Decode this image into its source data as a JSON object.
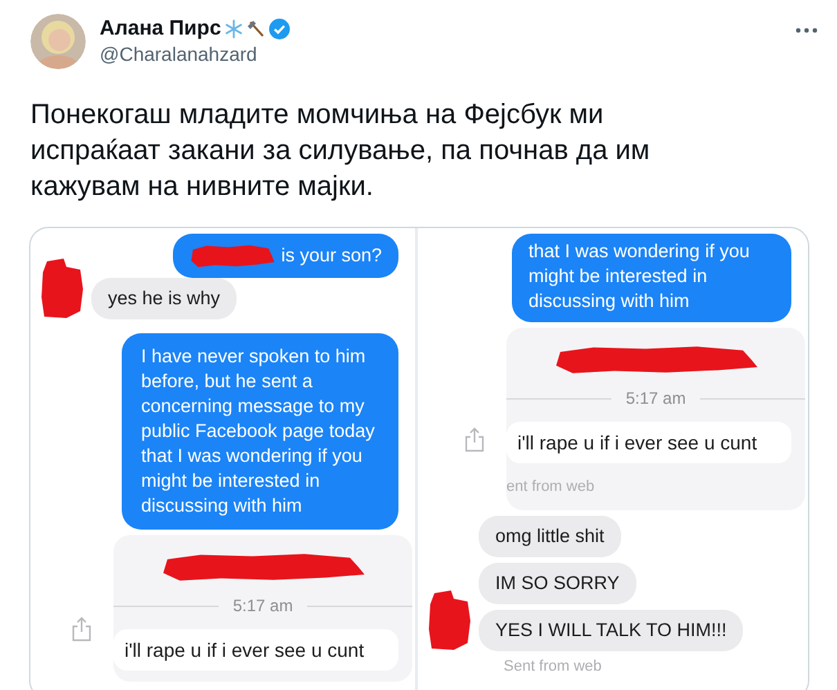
{
  "author": {
    "name": "Алана Пирс",
    "handle": "@Charalanahzard",
    "verified": true
  },
  "tweet": {
    "text": "Понекогаш младите момчиња на Фејсбук ми испраќаат закани за силување, па почнав да им кажувам на нивните мајки."
  },
  "media": {
    "panels": [
      {
        "messages": [
          {
            "kind": "sent",
            "text": "is your son?",
            "redacted": true
          },
          {
            "kind": "received",
            "text": "yes he is why",
            "avatar": true
          },
          {
            "kind": "sent",
            "text": "I have never spoken to him before, but he sent a concerning message to my public Facebook page today that I was wondering if you might be interested in discussing with him",
            "redacted": false
          },
          {
            "kind": "shared",
            "time": "5:17 am",
            "text": "i'll rape u if i ever see u cunt"
          }
        ]
      },
      {
        "messages": [
          {
            "kind": "sent",
            "text": "that I was wondering if you might be interested in discussing with him",
            "redacted": false
          },
          {
            "kind": "shared",
            "time": "5:17 am",
            "text": "i'll rape u if i ever see u cunt",
            "note": "ent from web"
          },
          {
            "kind": "received",
            "text": "omg little shit",
            "avatar": false
          },
          {
            "kind": "received",
            "text": "IM SO SORRY",
            "avatar": false
          },
          {
            "kind": "received",
            "text": "YES I WILL TALK TO HIM!!!",
            "avatar": true
          },
          {
            "kind": "meta",
            "text": "Sent from web"
          }
        ]
      }
    ]
  }
}
